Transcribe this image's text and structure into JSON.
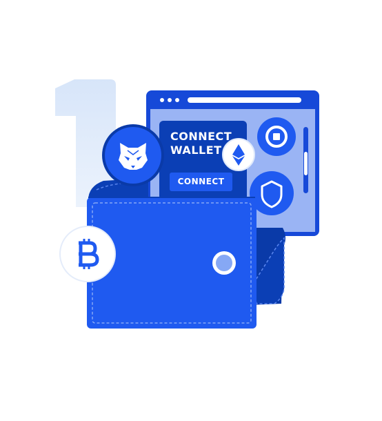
{
  "connect_panel": {
    "title_line1": "CONNECT",
    "title_line2": "WALLET",
    "button_label": "CONNECT"
  },
  "icons": {
    "metamask": "fox-icon",
    "ethereum": "ethereum-icon",
    "bitcoin": "bitcoin-icon",
    "shield": "shield-icon",
    "coin": "coin-icon"
  },
  "colors": {
    "primary_blue": "#1f5af0",
    "dark_blue": "#0b3fb5",
    "navy": "#0a3aa8",
    "light_panel": "#9ab4f4",
    "pale_blue": "#dfe9fb"
  }
}
